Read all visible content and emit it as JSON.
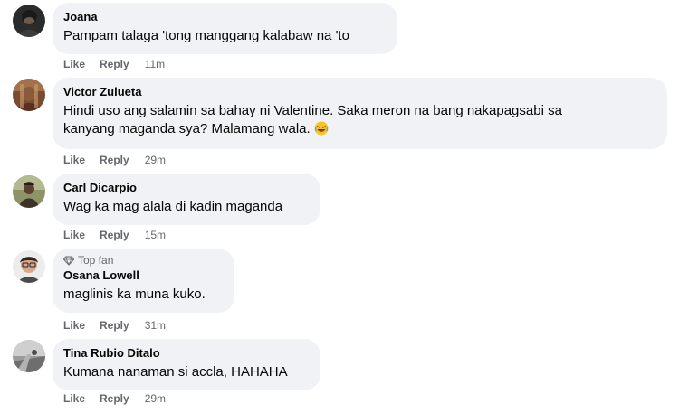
{
  "comments": [
    {
      "author": "Joana",
      "text": "Pampam talaga 'tong manggang kalabaw na 'to",
      "like": "Like",
      "reply": "Reply",
      "time": "11m"
    },
    {
      "author": "Victor Zulueta",
      "text_line1": "Hindi uso ang salamin sa bahay ni Valentine. Saka meron na bang nakapagsabi sa",
      "text_line2": "kanyang maganda sya? Malamang wala.",
      "emoji": "rolling-on-floor-laughing-emoji",
      "like": "Like",
      "reply": "Reply",
      "time": "29m"
    },
    {
      "author": "Carl Dicarpio",
      "text": "Wag ka mag alala di kadin maganda",
      "like": "Like",
      "reply": "Reply",
      "time": "15m"
    },
    {
      "badge": "Top fan",
      "badge_icon": "diamond-icon",
      "author": "Osana Lowell",
      "text": "maglinis ka muna kuko.",
      "like": "Like",
      "reply": "Reply",
      "time": "31m"
    },
    {
      "author": "Tina Rubio Ditalo",
      "text": "Kumana nanaman si accla, HAHAHA",
      "like": "Like",
      "reply": "Reply",
      "time": "29m"
    }
  ],
  "colors": {
    "bubble": "#f0f2f5",
    "text": "#050505",
    "secondary": "#65676b"
  }
}
